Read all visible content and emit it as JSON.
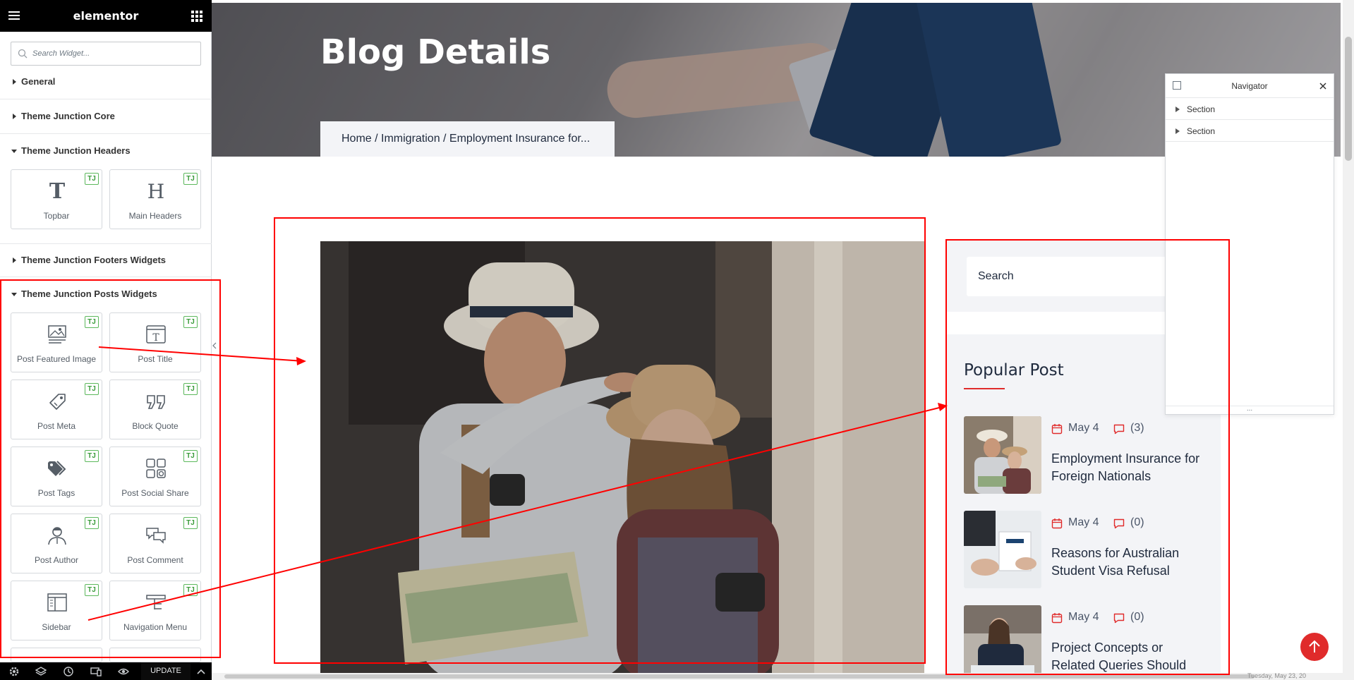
{
  "panel": {
    "logo": "elementor",
    "search_placeholder": "Search Widget...",
    "categories": [
      {
        "title": "General"
      },
      {
        "title": "Theme Junction Core"
      },
      {
        "title": "Theme Junction Headers"
      },
      {
        "title": "Theme Junction Footers Widgets"
      },
      {
        "title": "Theme Junction Posts Widgets"
      }
    ],
    "badge": "TJ",
    "header_widgets": [
      {
        "label": "Topbar",
        "icon": "topbar-icon"
      },
      {
        "label": "Main Headers",
        "icon": "heading-icon"
      }
    ],
    "post_widgets": [
      {
        "label": "Post Featured Image",
        "icon": "image-icon"
      },
      {
        "label": "Post Title",
        "icon": "title-icon"
      },
      {
        "label": "Post Meta",
        "icon": "tag-icon"
      },
      {
        "label": "Block Quote",
        "icon": "quote-icon"
      },
      {
        "label": "Post Tags",
        "icon": "tags-icon"
      },
      {
        "label": "Post Social Share",
        "icon": "social-share-icon"
      },
      {
        "label": "Post Author",
        "icon": "author-icon"
      },
      {
        "label": "Post Comment",
        "icon": "comment-icon"
      },
      {
        "label": "Sidebar",
        "icon": "sidebar-icon"
      },
      {
        "label": "Navigation Menu",
        "icon": "nav-menu-icon"
      }
    ],
    "footer": {
      "update_label": "UPDATE"
    }
  },
  "page": {
    "title": "Blog Details",
    "breadcrumb": "Home / Immigration / Employment Insurance for..."
  },
  "sidebar": {
    "search_placeholder": "Search",
    "popular_title": "Popular Post",
    "posts": [
      {
        "date": "May 4",
        "comments": "(3)",
        "title": "Employment Insurance for Foreign Nationals"
      },
      {
        "date": "May 4",
        "comments": "(0)",
        "title": "Reasons for Australian Student Visa Refusal"
      },
      {
        "date": "May 4",
        "comments": "(0)",
        "title": "Project Concepts or Related Queries Should"
      }
    ]
  },
  "navigator": {
    "title": "Navigator",
    "rows": [
      {
        "label": "Section"
      },
      {
        "label": "Section"
      }
    ],
    "resize_glyph": "..."
  },
  "taskbar": {
    "clock": "Tuesday, May 23, 20"
  },
  "colors": {
    "accent": "#e02b2b",
    "panel_dark": "#000000",
    "badge_green": "#5cb85c",
    "light_bg": "#f3f4f7"
  }
}
